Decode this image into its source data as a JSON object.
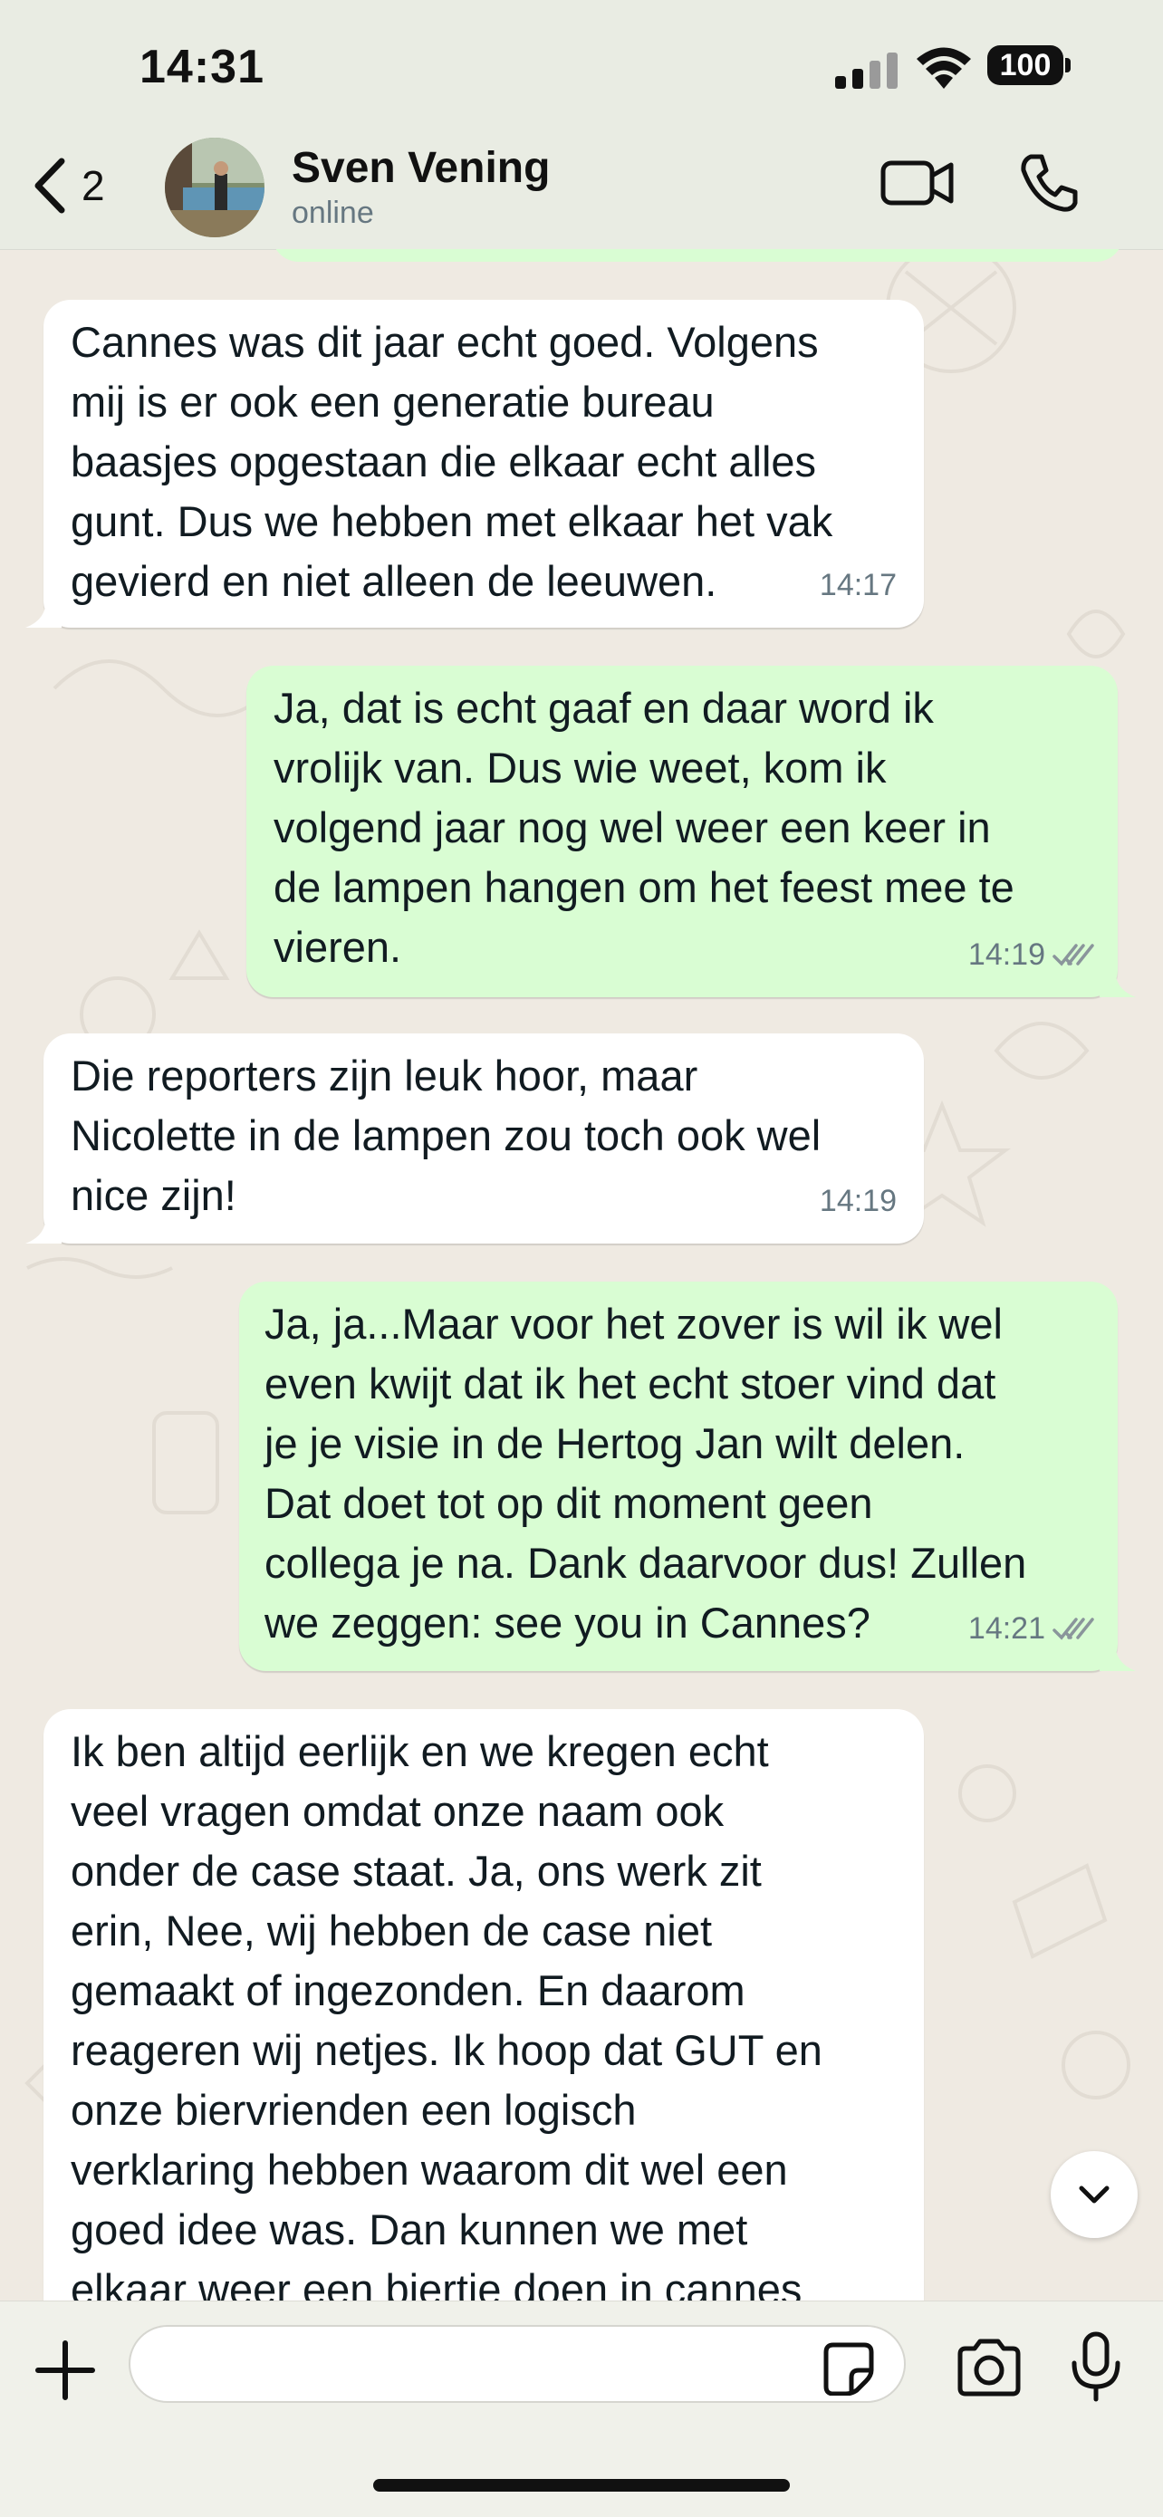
{
  "status_bar": {
    "time": "14:31",
    "battery": "100"
  },
  "header": {
    "back_count": "2",
    "contact_name": "Sven Vening",
    "contact_status": "online"
  },
  "messages": [
    {
      "direction": "incoming",
      "text": "Cannes was dit jaar echt goed. Volgens\nmij is er ook een generatie bureau\nbaasjes opgestaan die elkaar echt alles\ngunt. Dus we hebben met elkaar het vak\ngevierd en niet alleen de leeuwen.",
      "time": "14:17"
    },
    {
      "direction": "outgoing",
      "text": "Ja, dat is echt gaaf en daar word ik\nvrolijk van. Dus wie weet, kom ik\nvolgend jaar nog wel weer een keer in\nde lampen hangen om het feest mee te\nvieren.",
      "time": "14:19",
      "read": true
    },
    {
      "direction": "incoming",
      "text": "Die reporters zijn leuk hoor, maar\nNicolette in de lampen zou toch ook wel\nnice zijn!",
      "time": "14:19"
    },
    {
      "direction": "outgoing",
      "text": "Ja, ja...Maar voor het zover is wil ik wel\neven kwijt dat ik het echt stoer vind dat\nje je visie in de Hertog Jan wilt delen.\nDat doet tot op dit moment geen\ncollega je na. Dank daarvoor dus! Zullen\nwe zeggen: see you in Cannes?",
      "time": "14:21",
      "read": true
    },
    {
      "direction": "incoming",
      "text": "Ik ben altijd eerlijk en we kregen echt\nveel vragen omdat onze naam ook\nonder de case staat. Ja, ons werk zit\nerin, Nee, wij hebben de case niet\ngemaakt of ingezonden. En daarom\nreageren wij netjes. Ik hoop dat GUT en\nonze biervrienden een logisch\nverklaring hebben waarom dit wel een\ngoed idee was. Dan kunnen we met\nelkaar weer een biertje doen in cannes",
      "time": ""
    }
  ],
  "composer": {
    "input_value": "",
    "input_placeholder": ""
  },
  "icons": {
    "back": "chevron-left-icon",
    "video": "video-camera-icon",
    "call": "phone-icon",
    "scroll": "chevron-down-icon",
    "plus": "plus-icon",
    "sticker": "sticker-icon",
    "camera": "camera-icon",
    "mic": "microphone-icon",
    "read_receipt": "double-check-icon"
  },
  "colors": {
    "incoming_bubble": "#ffffff",
    "outgoing_bubble": "#d9fdd3",
    "chat_background": "#efeae2",
    "header_background": "#e9ece3",
    "meta_text": "#667781"
  }
}
